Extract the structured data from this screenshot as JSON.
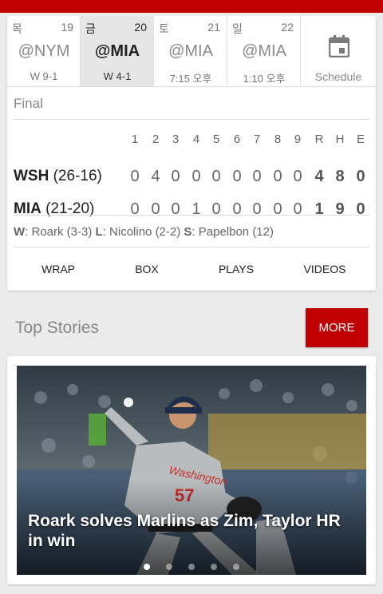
{
  "schedule": {
    "days": [
      {
        "dow": "목",
        "date": "19",
        "opponent": "@NYM",
        "result": "W 9-1",
        "selected": false
      },
      {
        "dow": "금",
        "date": "20",
        "opponent": "@MIA",
        "result": "W 4-1",
        "selected": true
      },
      {
        "dow": "토",
        "date": "21",
        "opponent": "@MIA",
        "result": "7:15 오후",
        "selected": false
      },
      {
        "dow": "일",
        "date": "22",
        "opponent": "@MIA",
        "result": "1:10 오후",
        "selected": false
      }
    ],
    "schedule_label": "Schedule",
    "schedule_icon": "calendar-icon"
  },
  "game": {
    "status": "Final",
    "inning_headers": [
      "1",
      "2",
      "3",
      "4",
      "5",
      "6",
      "7",
      "8",
      "9"
    ],
    "total_headers": [
      "R",
      "H",
      "E"
    ],
    "away": {
      "abbr": "WSH",
      "record": "(26-16)",
      "innings": [
        "0",
        "4",
        "0",
        "0",
        "0",
        "0",
        "0",
        "0",
        "0"
      ],
      "totals": [
        "4",
        "8",
        "0"
      ]
    },
    "home": {
      "abbr": "MIA",
      "record": "(21-20)",
      "innings": [
        "0",
        "0",
        "0",
        "1",
        "0",
        "0",
        "0",
        "0",
        "0"
      ],
      "totals": [
        "1",
        "9",
        "0"
      ]
    },
    "decisions": {
      "w_label": "W",
      "w_text": ": Roark (3-3)",
      "l_label": "L",
      "l_text": ": Nicolino (2-2)",
      "s_label": "S",
      "s_text": ": Papelbon (12)"
    },
    "tabs": [
      "WRAP",
      "BOX",
      "PLAYS",
      "VIDEOS"
    ]
  },
  "top_stories": {
    "title": "Top Stories",
    "more_label": "MORE",
    "headline": "Roark solves Marlins as Zim, Taylor HR in win",
    "dot_count": 5,
    "active_dot": 0
  },
  "colors": {
    "accent": "#c00000",
    "background": "#ebebeb",
    "card": "#ffffff"
  }
}
